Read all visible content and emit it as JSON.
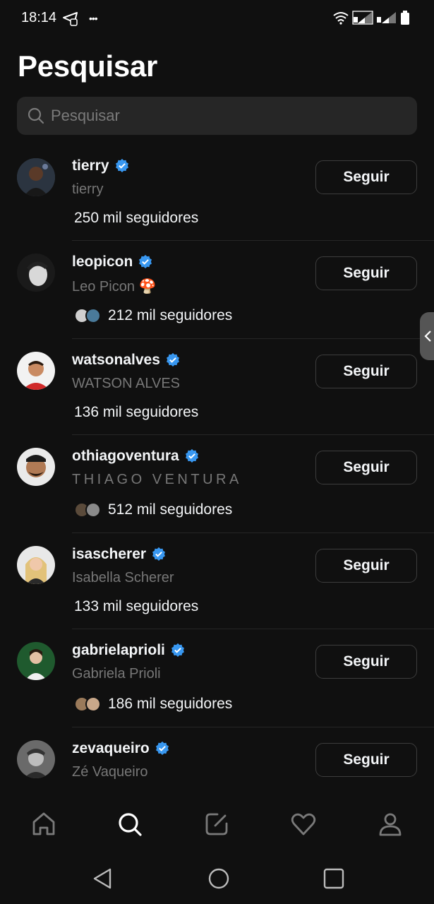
{
  "status_bar": {
    "time": "18:14"
  },
  "header": {
    "title": "Pesquisar"
  },
  "search": {
    "placeholder": "Pesquisar",
    "value": ""
  },
  "accent": {
    "verified": "#3897f0",
    "background": "#101010",
    "search_bg": "#262626"
  },
  "results": [
    {
      "username": "tierry",
      "full_name": "tierry",
      "followers": "250 mil seguidores",
      "verified": true,
      "button": "Seguir",
      "has_mutuals": false
    },
    {
      "username": "leopicon",
      "full_name": "Leo Picon 🍄",
      "followers": "212 mil seguidores",
      "verified": true,
      "button": "Seguir",
      "has_mutuals": true
    },
    {
      "username": "watsonalves",
      "full_name": "WATSON ALVES",
      "followers": "136 mil seguidores",
      "verified": true,
      "button": "Seguir",
      "has_mutuals": false
    },
    {
      "username": "othiagoventura",
      "full_name": "THIAGO VENTURA",
      "followers": "512 mil seguidores",
      "verified": true,
      "button": "Seguir",
      "has_mutuals": true
    },
    {
      "username": "isascherer",
      "full_name": "Isabella Scherer",
      "followers": "133 mil seguidores",
      "verified": true,
      "button": "Seguir",
      "has_mutuals": false
    },
    {
      "username": "gabrielaprioli",
      "full_name": "Gabriela Prioli",
      "followers": "186 mil seguidores",
      "verified": true,
      "button": "Seguir",
      "has_mutuals": true
    },
    {
      "username": "zevaqueiro",
      "full_name": "Zé Vaqueiro",
      "followers": "",
      "verified": true,
      "button": "Seguir",
      "has_mutuals": false
    }
  ],
  "bottom_nav": [
    {
      "icon": "home-icon",
      "active": false
    },
    {
      "icon": "search-icon",
      "active": true
    },
    {
      "icon": "compose-icon",
      "active": false
    },
    {
      "icon": "heart-icon",
      "active": false
    },
    {
      "icon": "profile-icon",
      "active": false
    }
  ],
  "system_nav": [
    {
      "icon": "back-icon"
    },
    {
      "icon": "home-circle-icon"
    },
    {
      "icon": "recents-icon"
    }
  ]
}
